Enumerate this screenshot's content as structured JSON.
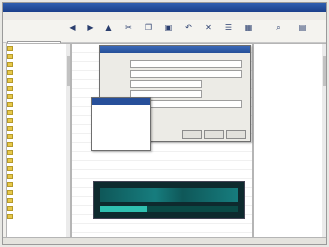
{
  "window": {
    "title": ""
  },
  "menu": {
    "items": [
      "",
      "",
      "",
      "",
      "",
      "",
      ""
    ]
  },
  "toolbar": {
    "buttons": [
      {
        "icon": "back-icon",
        "label": ""
      },
      {
        "icon": "forward-icon",
        "label": ""
      },
      {
        "icon": "up-icon",
        "label": ""
      },
      {
        "icon": "cut-icon",
        "label": ""
      },
      {
        "icon": "copy-icon",
        "label": ""
      },
      {
        "icon": "paste-icon",
        "label": ""
      },
      {
        "icon": "undo-icon",
        "label": ""
      },
      {
        "icon": "delete-icon",
        "label": ""
      },
      {
        "icon": "properties-icon",
        "label": ""
      },
      {
        "icon": "views-icon",
        "label": ""
      },
      {
        "icon": "search-icon",
        "label": ""
      },
      {
        "icon": "folders-icon",
        "label": ""
      }
    ]
  },
  "colors": {
    "title": "#1f4a9a",
    "selection": "#c8312b",
    "media": "#0e2a2e"
  },
  "media": {
    "progress": 0.34
  }
}
